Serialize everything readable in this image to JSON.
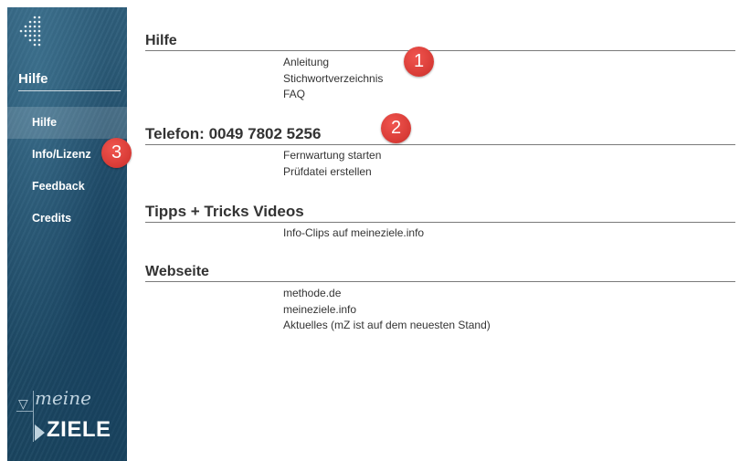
{
  "sidebar": {
    "title": "Hilfe",
    "nav": [
      {
        "label": "Hilfe",
        "active": true
      },
      {
        "label": "Info/Lizenz",
        "active": false
      },
      {
        "label": "Feedback",
        "active": false
      },
      {
        "label": "Credits",
        "active": false
      }
    ],
    "brand": {
      "meine": "meine",
      "ziele": "ZIELE"
    }
  },
  "sections": [
    {
      "title": "Hilfe",
      "links": [
        "Anleitung",
        "Stichwortverzeichnis",
        "FAQ"
      ]
    },
    {
      "title": "Telefon: 0049 7802 5256",
      "links": [
        "Fernwartung starten",
        "Prüfdatei erstellen"
      ]
    },
    {
      "title": "Tipps + Tricks Videos",
      "links": [
        "Info-Clips auf meineziele.info"
      ]
    },
    {
      "title": "Webseite",
      "links": [
        "methode.de",
        "meineziele.info",
        "Aktuelles (mZ ist auf dem neuesten Stand)"
      ]
    }
  ],
  "callouts": [
    "1",
    "2",
    "3"
  ],
  "colors": {
    "sidebar": "#264f6c",
    "callout": "#d9403a",
    "text": "#333333"
  }
}
